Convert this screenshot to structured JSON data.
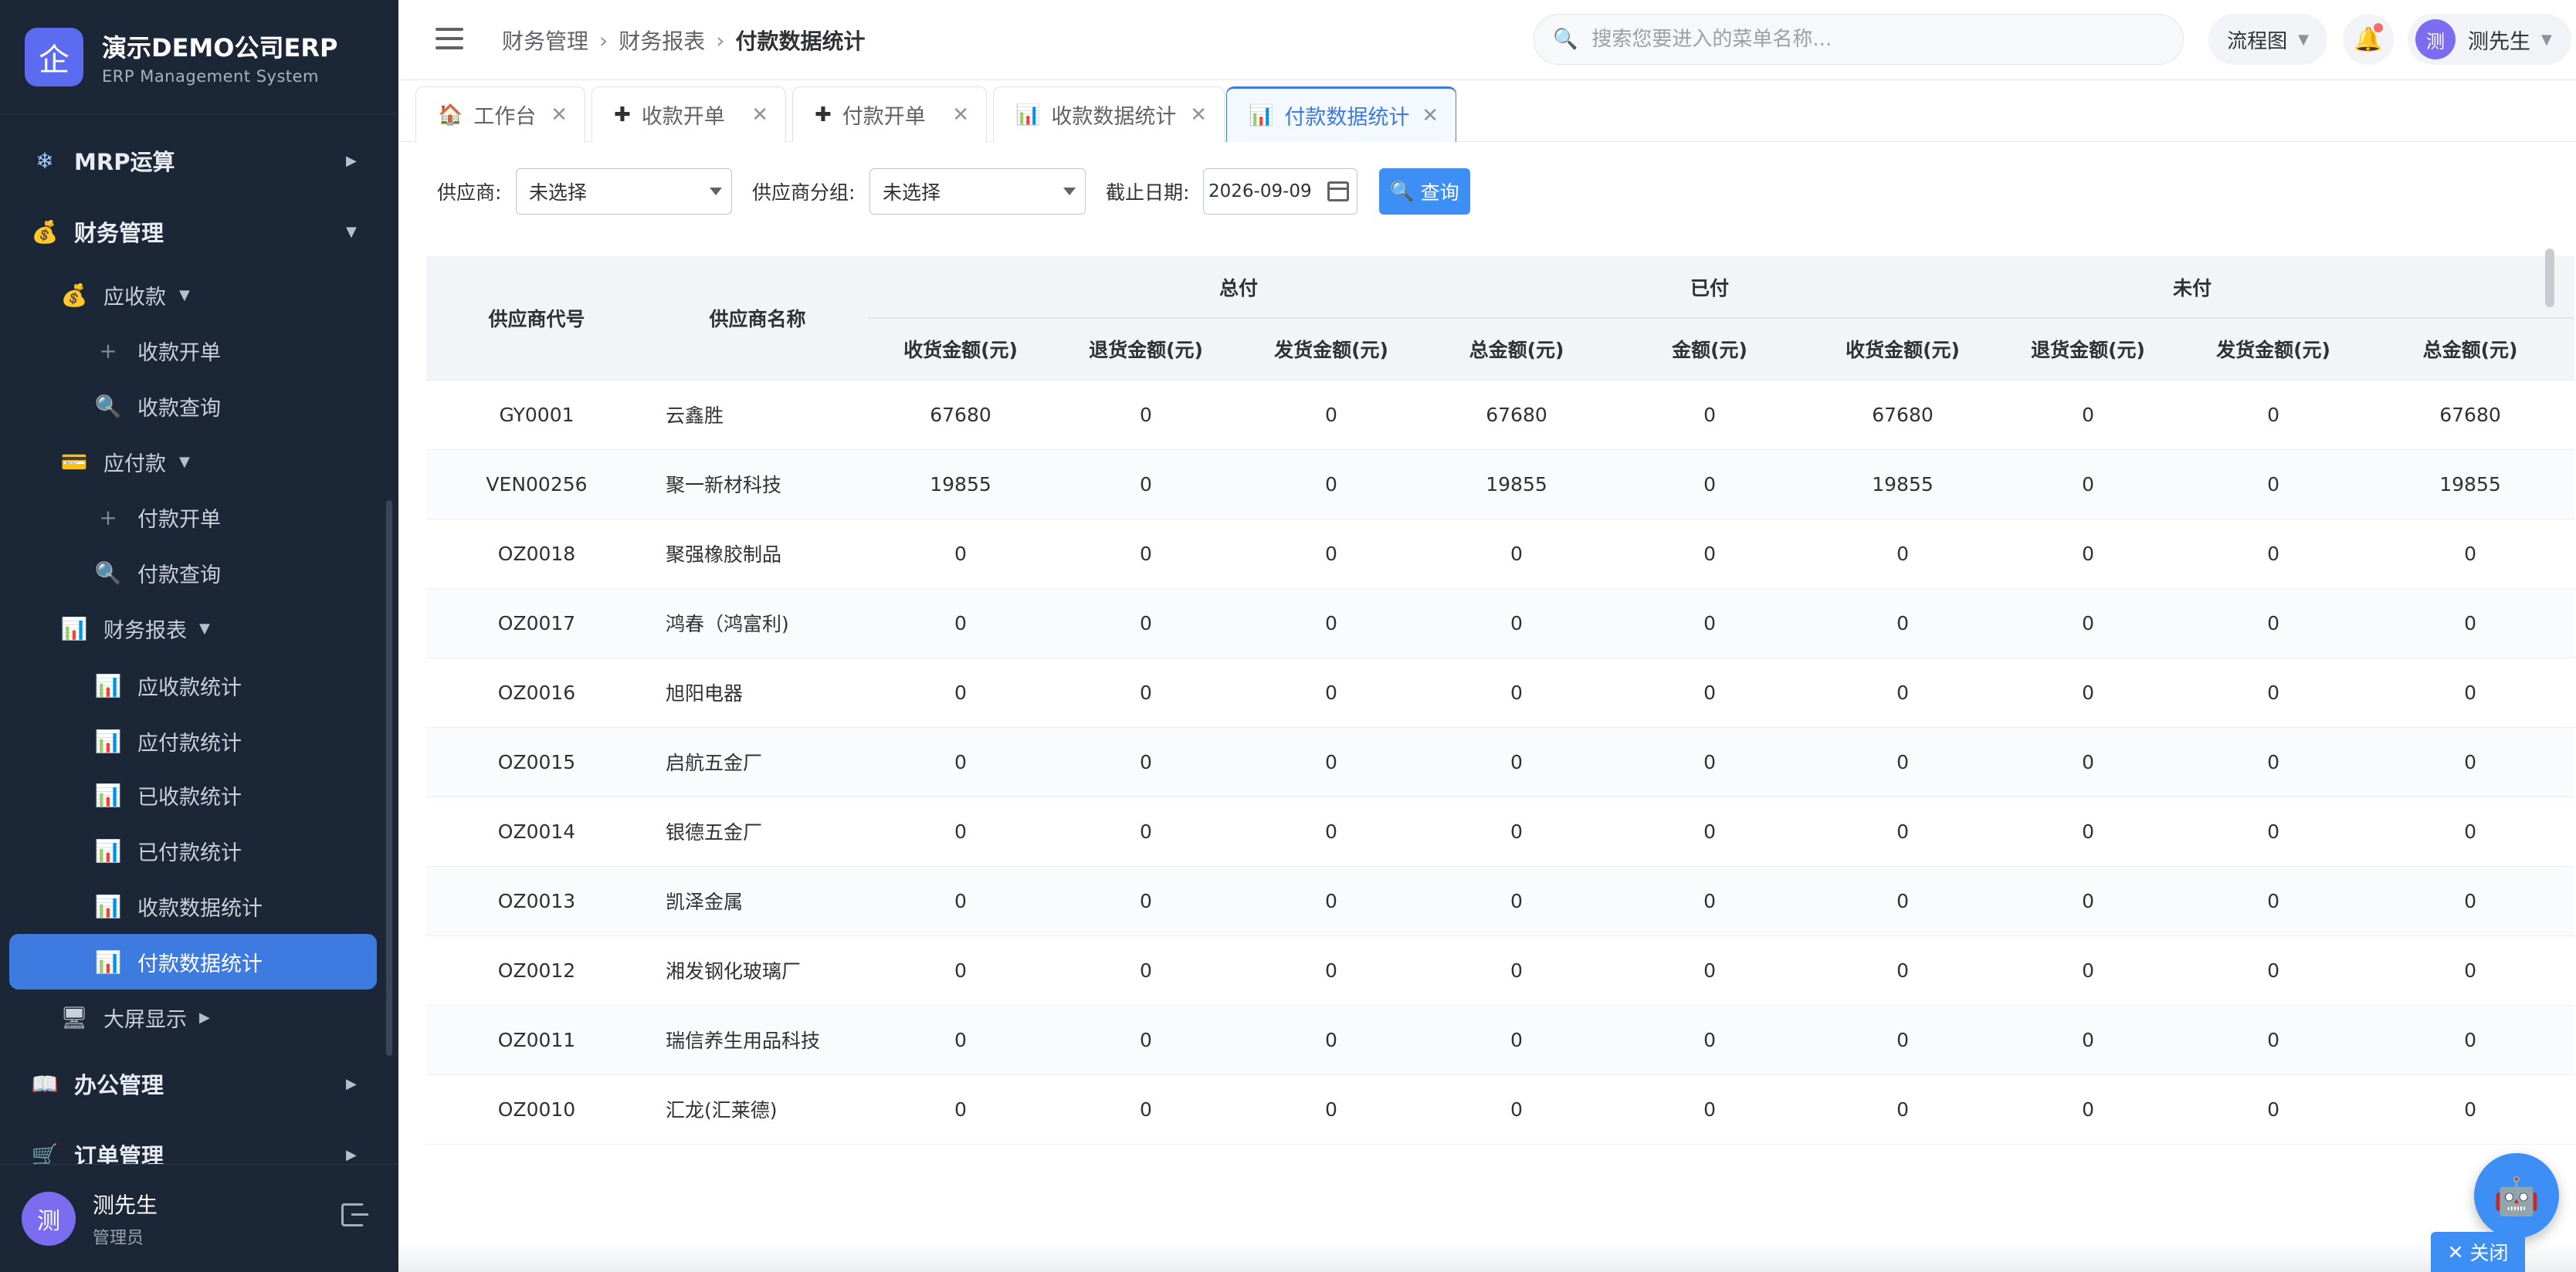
{
  "brand": {
    "logo_char": "企",
    "title": "演示DEMO公司ERP",
    "subtitle": "ERP Management System"
  },
  "sidebar": {
    "items": [
      {
        "label": "MRP运算",
        "icon": "❄"
      },
      {
        "label": "财务管理",
        "icon": "💰"
      },
      {
        "label": "应收款",
        "icon": "💰"
      },
      {
        "label": "收款开单",
        "icon": "+"
      },
      {
        "label": "收款查询",
        "icon": "🔍"
      },
      {
        "label": "应付款",
        "icon": "💳"
      },
      {
        "label": "付款开单",
        "icon": "+"
      },
      {
        "label": "付款查询",
        "icon": "🔍"
      },
      {
        "label": "财务报表",
        "icon": "📊"
      },
      {
        "label": "应收款统计",
        "icon": "📊"
      },
      {
        "label": "应付款统计",
        "icon": "📊"
      },
      {
        "label": "已收款统计",
        "icon": "📊"
      },
      {
        "label": "已付款统计",
        "icon": "📊"
      },
      {
        "label": "收款数据统计",
        "icon": "📊"
      },
      {
        "label": "付款数据统计",
        "icon": "📊"
      },
      {
        "label": "大屏显示",
        "icon": "🖥"
      },
      {
        "label": "办公管理",
        "icon": "📖"
      },
      {
        "label": "订单管理",
        "icon": "🛒"
      }
    ],
    "user": {
      "avatar_char": "测",
      "name": "测先生",
      "role": "管理员"
    }
  },
  "topbar": {
    "breadcrumbs": [
      "财务管理",
      "财务报表",
      "付款数据统计"
    ],
    "search_placeholder": "搜索您要进入的菜单名称...",
    "flow_label": "流程图",
    "user": {
      "avatar_char": "测",
      "name": "测先生"
    }
  },
  "tabs": [
    {
      "label": "工作台",
      "icon": "🏠"
    },
    {
      "label": "收款开单",
      "icon": "✚"
    },
    {
      "label": "付款开单",
      "icon": "✚"
    },
    {
      "label": "收款数据统计",
      "icon": "📊"
    },
    {
      "label": "付款数据统计",
      "icon": "📊",
      "active": true
    }
  ],
  "filters": {
    "supplier_label": "供应商:",
    "supplier_value": "未选择",
    "group_label": "供应商分组:",
    "group_value": "未选择",
    "date_label": "截止日期:",
    "date_value": "2026-09-09",
    "query_label": "查询"
  },
  "table": {
    "col_code": "供应商代号",
    "col_name": "供应商名称",
    "groups": [
      "总付",
      "已付",
      "未付"
    ],
    "sub_headers": [
      "收货金额(元)",
      "退货金额(元)",
      "发货金额(元)",
      "总金额(元)",
      "金额(元)",
      "收货金额(元)",
      "退货金额(元)",
      "发货金额(元)",
      "总金额(元)"
    ],
    "rows": [
      [
        "GY0001",
        "云鑫胜",
        "67680",
        "0",
        "0",
        "67680",
        "0",
        "67680",
        "0",
        "0",
        "67680"
      ],
      [
        "VEN00256",
        "聚一新材科技",
        "19855",
        "0",
        "0",
        "19855",
        "0",
        "19855",
        "0",
        "0",
        "19855"
      ],
      [
        "OZ0018",
        "聚强橡胶制品",
        "0",
        "0",
        "0",
        "0",
        "0",
        "0",
        "0",
        "0",
        "0"
      ],
      [
        "OZ0017",
        "鸿春（鸿富利)",
        "0",
        "0",
        "0",
        "0",
        "0",
        "0",
        "0",
        "0",
        "0"
      ],
      [
        "OZ0016",
        "旭阳电器",
        "0",
        "0",
        "0",
        "0",
        "0",
        "0",
        "0",
        "0",
        "0"
      ],
      [
        "OZ0015",
        "启航五金厂",
        "0",
        "0",
        "0",
        "0",
        "0",
        "0",
        "0",
        "0",
        "0"
      ],
      [
        "OZ0014",
        "银德五金厂",
        "0",
        "0",
        "0",
        "0",
        "0",
        "0",
        "0",
        "0",
        "0"
      ],
      [
        "OZ0013",
        "凯泽金属",
        "0",
        "0",
        "0",
        "0",
        "0",
        "0",
        "0",
        "0",
        "0"
      ],
      [
        "OZ0012",
        "湘发钢化玻璃厂",
        "0",
        "0",
        "0",
        "0",
        "0",
        "0",
        "0",
        "0",
        "0"
      ],
      [
        "OZ0011",
        "瑞信养生用品科技",
        "0",
        "0",
        "0",
        "0",
        "0",
        "0",
        "0",
        "0",
        "0"
      ],
      [
        "OZ0010",
        "汇龙(汇莱德)",
        "0",
        "0",
        "0",
        "0",
        "0",
        "0",
        "0",
        "0",
        "0"
      ]
    ]
  },
  "floating": {
    "close_label": "关闭"
  },
  "colors": {
    "accent": "#3d7be0",
    "sidebar_bg": "#1b2636",
    "button": "#3d8ef5"
  }
}
